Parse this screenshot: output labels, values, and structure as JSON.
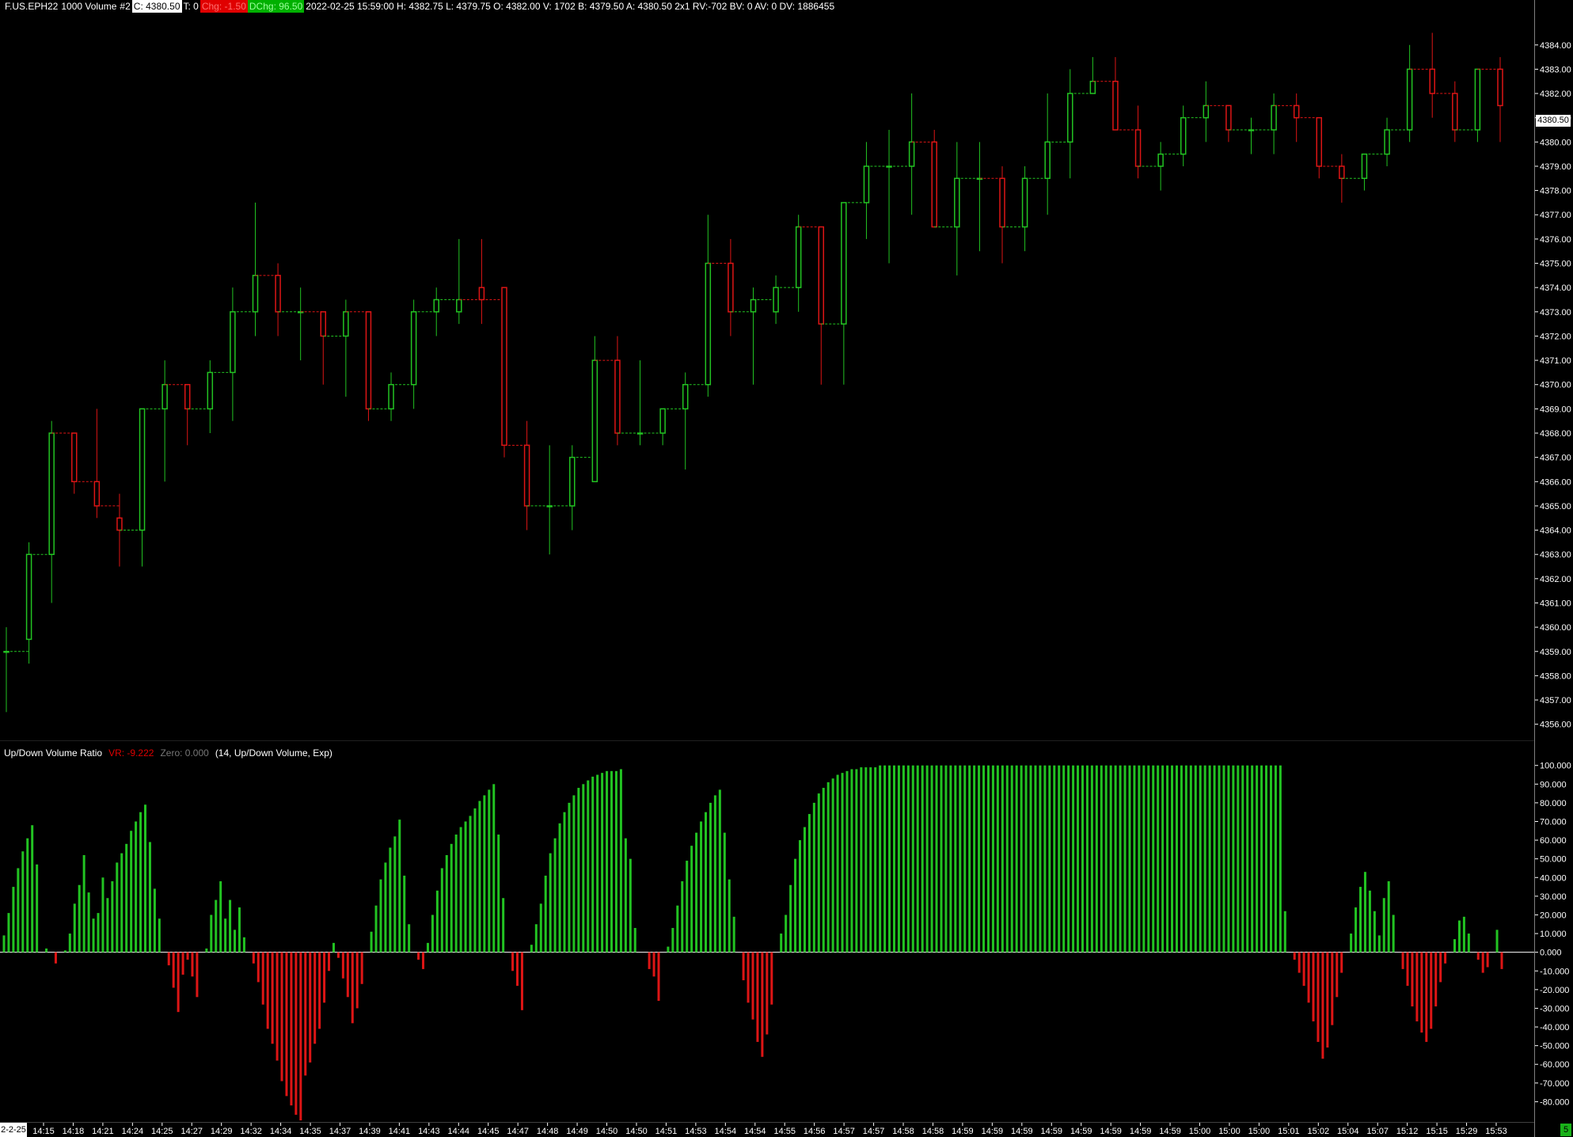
{
  "header": {
    "symbol": "F.US.EPH22",
    "bar_period": "1000 Volume",
    "chart_number": "#2",
    "close_label": "C: 4380.50",
    "tick_label": "T: 0",
    "change_label": "Chg: -1.50",
    "daily_change_label": "DChg: 96.50",
    "stats": "2022-02-25 15:59:00 H: 4382.75 L: 4379.75 O: 4382.00 V: 1702 B: 4379.50 A: 4380.50 2x1 RV:-702 BV: 0 AV: 0 DV: 1886455"
  },
  "indicator": {
    "name": "Up/Down Volume Ratio",
    "vr_label": "VR: -9.222",
    "zero_label": "Zero: 0.000",
    "params": "(14, Up/Down Volume, Exp)"
  },
  "current_price_tag": "4380.50",
  "corner_left": "2-2-25",
  "corner_right": "5",
  "colors": {
    "up": "#22c322",
    "down": "#dd1515",
    "background": "#000000",
    "axis_text": "#ffffff",
    "divider": "#808080"
  },
  "chart_data": [
    {
      "type": "candlestick",
      "y_ticks": [
        "4384.00",
        "4383.00",
        "4382.00",
        "4381.00",
        "4380.00",
        "4379.00",
        "4378.00",
        "4377.00",
        "4376.00",
        "4375.00",
        "4374.00",
        "4373.00",
        "4372.00",
        "4371.00",
        "4370.00",
        "4369.00",
        "4368.00",
        "4367.00",
        "4366.00",
        "4365.00",
        "4364.00",
        "4363.00",
        "4362.00",
        "4361.00",
        "4360.00",
        "4359.00",
        "4358.00",
        "4357.00",
        "4356.00"
      ],
      "ylim": [
        4355.5,
        4385.2
      ],
      "candles": [
        [
          4359.0,
          4360.0,
          4356.5,
          4359.0
        ],
        [
          4359.5,
          4363.5,
          4358.5,
          4363.0
        ],
        [
          4363.0,
          4368.5,
          4361.0,
          4368.0
        ],
        [
          4368.0,
          4368.0,
          4365.5,
          4366.0
        ],
        [
          4366.0,
          4369.0,
          4364.5,
          4365.0
        ],
        [
          4364.5,
          4365.5,
          4362.5,
          4364.0
        ],
        [
          4364.0,
          4369.0,
          4362.5,
          4369.0
        ],
        [
          4369.0,
          4371.0,
          4366.0,
          4370.0
        ],
        [
          4370.0,
          4370.0,
          4367.5,
          4369.0
        ],
        [
          4369.0,
          4371.0,
          4368.0,
          4370.5
        ],
        [
          4370.5,
          4374.0,
          4368.5,
          4373.0
        ],
        [
          4373.0,
          4377.5,
          4372.0,
          4374.5
        ],
        [
          4374.5,
          4375.0,
          4372.0,
          4373.0
        ],
        [
          4373.0,
          4374.0,
          4371.0,
          4373.0
        ],
        [
          4373.0,
          4373.0,
          4370.0,
          4372.0
        ],
        [
          4372.0,
          4373.5,
          4369.5,
          4373.0
        ],
        [
          4373.0,
          4373.0,
          4368.5,
          4369.0
        ],
        [
          4369.0,
          4370.5,
          4368.5,
          4370.0
        ],
        [
          4370.0,
          4373.5,
          4369.0,
          4373.0
        ],
        [
          4373.0,
          4374.0,
          4372.0,
          4373.5
        ],
        [
          4373.0,
          4376.0,
          4372.5,
          4373.5
        ],
        [
          4374.0,
          4376.0,
          4372.5,
          4373.5
        ],
        [
          4374.0,
          4374.0,
          4367.0,
          4367.5
        ],
        [
          4367.5,
          4368.5,
          4364.0,
          4365.0
        ],
        [
          4365.0,
          4367.5,
          4363.0,
          4365.0
        ],
        [
          4365.0,
          4367.5,
          4364.0,
          4367.0
        ],
        [
          4366.0,
          4372.0,
          4366.0,
          4371.0
        ],
        [
          4371.0,
          4372.0,
          4367.5,
          4368.0
        ],
        [
          4368.0,
          4371.0,
          4367.5,
          4368.0
        ],
        [
          4368.0,
          4369.0,
          4367.5,
          4369.0
        ],
        [
          4369.0,
          4370.5,
          4366.5,
          4370.0
        ],
        [
          4370.0,
          4377.0,
          4369.5,
          4375.0
        ],
        [
          4375.0,
          4376.0,
          4372.0,
          4373.0
        ],
        [
          4373.0,
          4374.0,
          4370.0,
          4373.5
        ],
        [
          4373.0,
          4374.5,
          4372.5,
          4374.0
        ],
        [
          4374.0,
          4377.0,
          4373.0,
          4376.5
        ],
        [
          4376.5,
          4376.5,
          4370.0,
          4372.5
        ],
        [
          4372.5,
          4377.5,
          4370.0,
          4377.5
        ],
        [
          4377.5,
          4380.0,
          4376.0,
          4379.0
        ],
        [
          4379.0,
          4380.5,
          4375.0,
          4379.0
        ],
        [
          4379.0,
          4382.0,
          4377.0,
          4380.0
        ],
        [
          4380.0,
          4380.5,
          4376.5,
          4376.5
        ],
        [
          4376.5,
          4380.0,
          4374.5,
          4378.5
        ],
        [
          4378.5,
          4380.0,
          4375.5,
          4378.5
        ],
        [
          4378.5,
          4379.0,
          4375.0,
          4376.5
        ],
        [
          4376.5,
          4379.0,
          4375.5,
          4378.5
        ],
        [
          4378.5,
          4382.0,
          4377.0,
          4380.0
        ],
        [
          4380.0,
          4383.0,
          4378.5,
          4382.0
        ],
        [
          4382.0,
          4383.5,
          4382.0,
          4382.5
        ],
        [
          4382.5,
          4383.5,
          4380.5,
          4380.5
        ],
        [
          4380.5,
          4381.5,
          4378.5,
          4379.0
        ],
        [
          4379.0,
          4380.0,
          4378.0,
          4379.5
        ],
        [
          4379.5,
          4381.5,
          4379.0,
          4381.0
        ],
        [
          4381.0,
          4382.5,
          4380.0,
          4381.5
        ],
        [
          4381.5,
          4381.5,
          4380.0,
          4380.5
        ],
        [
          4380.5,
          4381.0,
          4379.5,
          4380.5
        ],
        [
          4380.5,
          4382.0,
          4379.5,
          4381.5
        ],
        [
          4381.5,
          4382.0,
          4380.0,
          4381.0
        ],
        [
          4381.0,
          4381.0,
          4378.5,
          4379.0
        ],
        [
          4379.0,
          4379.5,
          4377.5,
          4378.5
        ],
        [
          4378.5,
          4379.5,
          4378.0,
          4379.5
        ],
        [
          4379.5,
          4381.0,
          4379.0,
          4380.5
        ],
        [
          4380.5,
          4384.0,
          4380.0,
          4383.0
        ],
        [
          4383.0,
          4384.5,
          4381.0,
          4382.0
        ],
        [
          4382.0,
          4382.5,
          4380.0,
          4380.5
        ],
        [
          4380.5,
          4383.0,
          4380.0,
          4383.0
        ],
        [
          4383.0,
          4383.5,
          4380.0,
          4381.5
        ]
      ],
      "x_indices": [
        0,
        1,
        2,
        3,
        4,
        5,
        6,
        7,
        8,
        9,
        10,
        11,
        12,
        13,
        14,
        15,
        16,
        17,
        18,
        19,
        20,
        21,
        22,
        23,
        24,
        25,
        26,
        27,
        28,
        29,
        30,
        31,
        32,
        33,
        34,
        35,
        36,
        37,
        38,
        39,
        40,
        41,
        42,
        43,
        44,
        45,
        46,
        47,
        48,
        49,
        50,
        51,
        52,
        53,
        54,
        55,
        56,
        57,
        58,
        59,
        60,
        61,
        62,
        63,
        64,
        65,
        66
      ]
    },
    {
      "type": "bar",
      "title": "Up/Down Volume Ratio",
      "y_ticks": [
        "100.000",
        "90.000",
        "80.000",
        "70.000",
        "60.000",
        "50.000",
        "40.000",
        "30.000",
        "20.000",
        "10.000",
        "0.000",
        "-10.000",
        "-20.000",
        "-30.000",
        "-40.000",
        "-50.000",
        "-60.000",
        "-70.000",
        "-80.000"
      ],
      "ylim": [
        -90,
        102
      ],
      "values": [
        9,
        21,
        35,
        45,
        54,
        61,
        68,
        47,
        0,
        2,
        0,
        -6,
        0,
        1,
        10,
        26,
        36,
        52,
        32,
        18,
        21,
        40,
        29,
        38,
        48,
        53,
        58,
        65,
        70,
        75,
        79,
        59,
        34,
        18,
        0,
        -7,
        -19,
        -32,
        -12,
        -4,
        -13,
        -24,
        0,
        2,
        20,
        28,
        38,
        18,
        28,
        12,
        24,
        8,
        0,
        -6,
        -16,
        -28,
        -41,
        -49,
        -58,
        -69,
        -77,
        -82,
        -87,
        -90,
        -66,
        -59,
        -49,
        -41,
        -27,
        -10,
        5,
        -3,
        -14,
        -24,
        -38,
        -30,
        -17,
        0,
        11,
        25,
        39,
        48,
        56,
        62,
        71,
        41,
        15,
        0,
        -4,
        -9,
        5,
        20,
        33,
        45,
        52,
        58,
        63,
        67,
        70,
        73,
        77,
        81,
        84,
        87,
        90,
        63,
        29,
        0,
        -10,
        -18,
        -31,
        0,
        4,
        15,
        26,
        41,
        53,
        61,
        69,
        75,
        80,
        84,
        88,
        90,
        92,
        94,
        95,
        96,
        97,
        97,
        97,
        98,
        61,
        50,
        13,
        0,
        0,
        -9,
        -13,
        -26,
        0,
        3,
        13,
        25,
        38,
        49,
        57,
        64,
        70,
        75,
        80,
        84,
        87,
        64,
        39,
        19,
        0,
        -15,
        -27,
        -36,
        -48,
        -56,
        -44,
        -28,
        0,
        10,
        20,
        36,
        50,
        60,
        67,
        74,
        80,
        85,
        88,
        91,
        93,
        95,
        96,
        97,
        98,
        98,
        99,
        99,
        99,
        99,
        100,
        100,
        100,
        100,
        100,
        100,
        100,
        100,
        100,
        100,
        100,
        100,
        100,
        100,
        100,
        100,
        100,
        100,
        100,
        100,
        100,
        100,
        100,
        100,
        100,
        100,
        100,
        100,
        100,
        100,
        100,
        100,
        100,
        100,
        100,
        100,
        100,
        100,
        100,
        100,
        100,
        100,
        100,
        100,
        100,
        100,
        100,
        100,
        100,
        100,
        100,
        100,
        100,
        100,
        100,
        100,
        100,
        100,
        100,
        100,
        100,
        100,
        100,
        100,
        100,
        100,
        100,
        100,
        100,
        100,
        100,
        100,
        100,
        100,
        100,
        100,
        100,
        100,
        100,
        100,
        100,
        100,
        100,
        100,
        100,
        100,
        22,
        0,
        -4,
        -11,
        -18,
        -27,
        -37,
        -48,
        -57,
        -51,
        -39,
        -24,
        -11,
        0,
        10,
        24,
        35,
        43,
        33,
        22,
        9,
        29,
        38,
        20,
        0,
        -9,
        -18,
        -29,
        -37,
        -43,
        -48,
        -41,
        -29,
        -16,
        -6,
        0,
        7,
        17,
        19,
        10,
        0,
        -4,
        -11,
        -8,
        0,
        12,
        -9
      ],
      "x_labels": [
        "14:15",
        "14:18",
        "14:21",
        "14:24",
        "14:25",
        "14:27",
        "14:29",
        "14:32",
        "14:34",
        "14:35",
        "14:37",
        "14:39",
        "14:41",
        "14:43",
        "14:44",
        "14:45",
        "14:47",
        "14:48",
        "14:49",
        "14:50",
        "14:50",
        "14:51",
        "14:53",
        "14:54",
        "14:54",
        "14:55",
        "14:56",
        "14:57",
        "14:57",
        "14:58",
        "14:58",
        "14:59",
        "14:59",
        "14:59",
        "14:59",
        "14:59",
        "14:59",
        "14:59",
        "14:59",
        "15:00",
        "15:00",
        "15:00",
        "15:01",
        "15:02",
        "15:04",
        "15:07",
        "15:12",
        "15:15",
        "15:29",
        "15:53"
      ]
    }
  ]
}
